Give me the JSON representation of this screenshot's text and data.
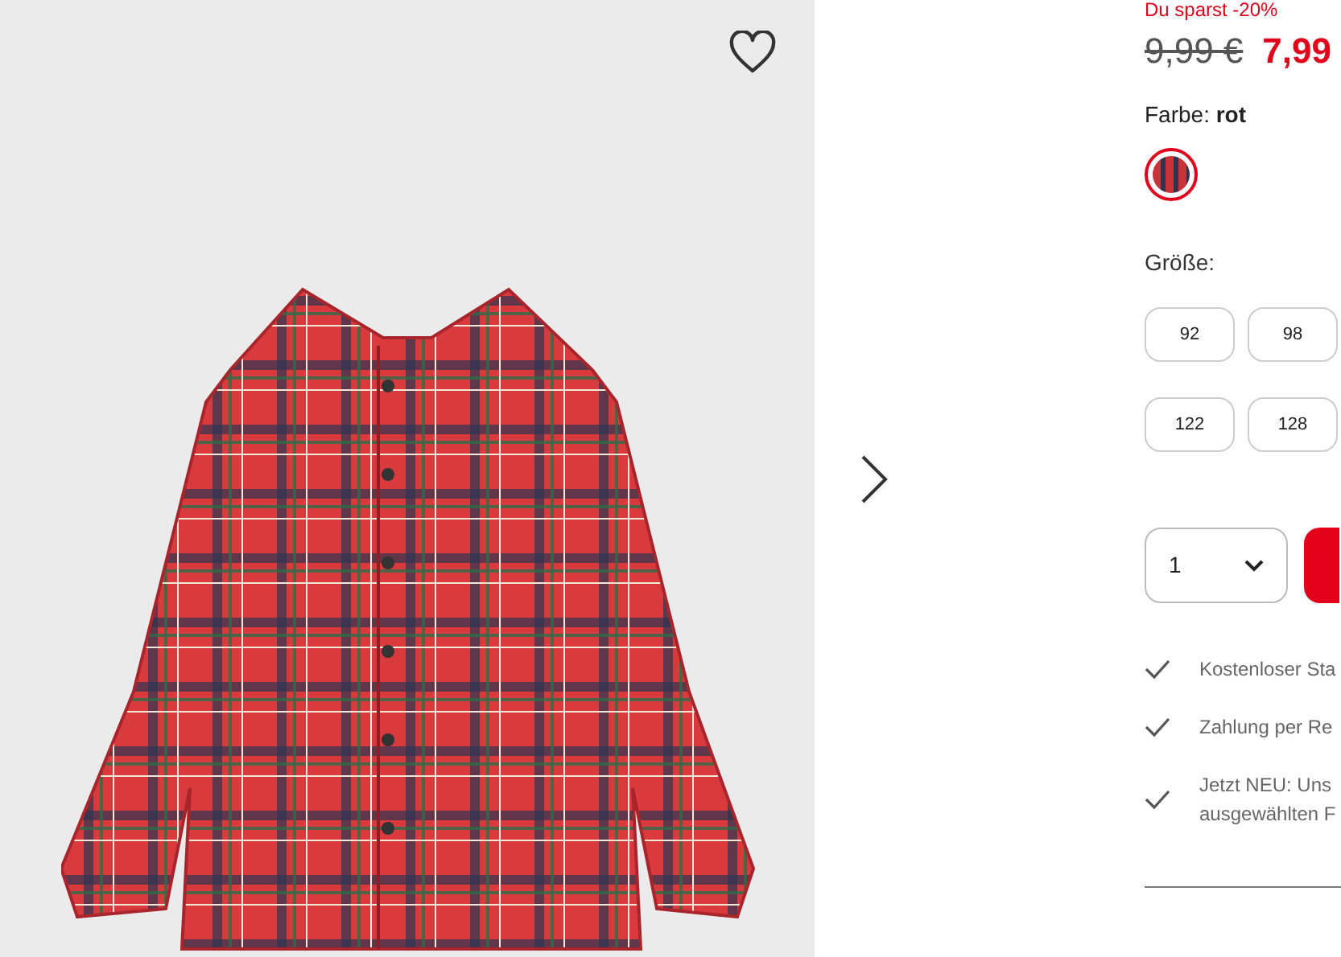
{
  "product_image": {
    "favorite": false
  },
  "price": {
    "discount_note": "Du sparst -20%",
    "old_price": "9,99 €",
    "new_price": "7,99"
  },
  "color": {
    "label": "Farbe:",
    "value": "rot",
    "swatches": [
      {
        "selected": true
      }
    ]
  },
  "size": {
    "label": "Größe:",
    "options": [
      {
        "label": "92",
        "selected": false
      },
      {
        "label": "98",
        "selected": false
      },
      {
        "label": "122",
        "selected": false
      },
      {
        "label": "128",
        "selected": false
      }
    ]
  },
  "quantity": {
    "value": "1"
  },
  "benefits": [
    {
      "lines": [
        "Kostenloser Sta"
      ]
    },
    {
      "lines": [
        "Zahlung per Re"
      ]
    },
    {
      "lines": [
        "Jetzt NEU: Uns",
        "ausgewählten F"
      ]
    }
  ]
}
